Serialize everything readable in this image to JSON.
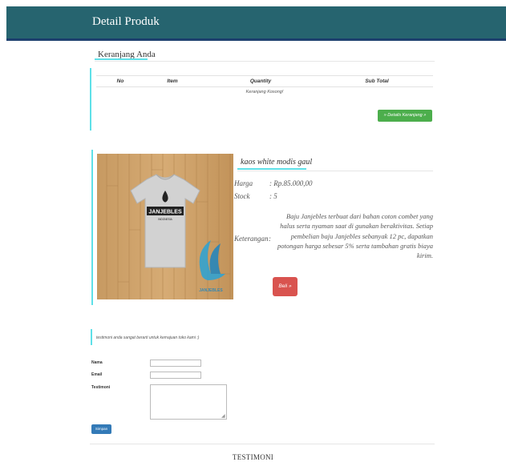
{
  "header": {
    "title": "Detail Produk"
  },
  "cart": {
    "title": "Keranjang Anda",
    "columns": [
      "No",
      "Item",
      "Quantity",
      "Sub Total"
    ],
    "empty_text": "Keranjang Kosong!",
    "details_button": "» Details Keranjang »"
  },
  "product": {
    "name": "kaos white modis gaul",
    "price_label": "Harga",
    "price_value": ": Rp.85.000,00",
    "stock_label": "Stock",
    "stock_value": ": 5",
    "desc_label": "Keterangan",
    "desc_sep": ":",
    "description": "Baju Janjebles terbuat dari bahan coton combet yang halus serta nyaman saat di gunakan beraktivitas. Setiap pembelian baju Janjebles sebanyak 12 pc, dapatkan potongan harga sebesar 5% serta tambahan gratis biaya kirim.",
    "buy_button": "Beli »",
    "image": {
      "shirt_brand": "JANJEBLES",
      "shirt_sub": "INDONESIA",
      "watermark": "JANJEBLES"
    }
  },
  "testimonial_form": {
    "note": "testimoni anda sangat berarti untuk kemajuan toko kami :)",
    "name_label": "Nama",
    "email_label": "Email",
    "testimoni_label": "Testimoni",
    "name_value": "",
    "email_value": "",
    "testimoni_value": "",
    "submit_button": "Simpan"
  },
  "footer": {
    "title": "TESTIMONI"
  },
  "colors": {
    "header": "#26646f",
    "accent": "#5ee0e8",
    "green": "#4cae4c",
    "red": "#d9534f",
    "blue": "#337ab7"
  }
}
